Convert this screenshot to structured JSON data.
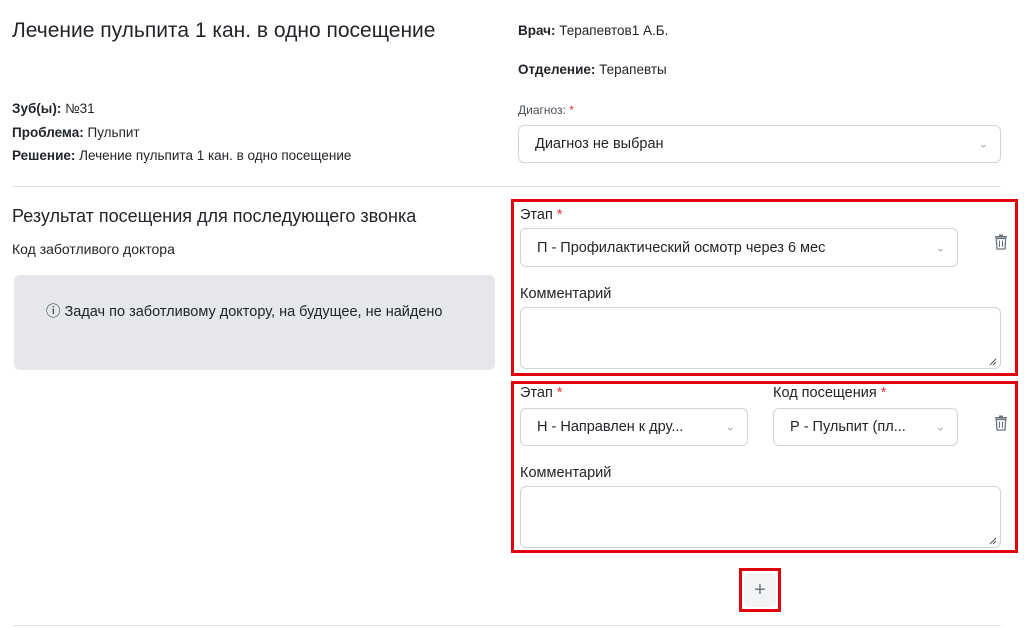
{
  "header": {
    "title": "Лечение пульпита 1 кан. в одно посещение",
    "teeth_label": "Зуб(ы):",
    "teeth_value": "№31",
    "problem_label": "Проблема:",
    "problem_value": "Пульпит",
    "solution_label": "Решение:",
    "solution_value": "Лечение пульпита 1 кан. в одно посещение"
  },
  "right_info": {
    "doctor_label": "Врач:",
    "doctor_value": "Терапевтов1 А.Б.",
    "department_label": "Отделение:",
    "department_value": "Терапевты",
    "diagnosis_label": "Диагноз:",
    "required_mark": "*",
    "diagnosis_value": "Диагноз не выбран"
  },
  "result_section": {
    "title": "Результат посещения для последующего звонка",
    "subtitle": "Код заботливого доктора",
    "alert_icon": "info-icon",
    "alert_text": "ⓘ Задач по заботливому доктору, на будущее, не найдено"
  },
  "entries": [
    {
      "stage_label": "Этап",
      "stage_value": "П - Профилактический осмотр через 6 мес",
      "comment_label": "Комментарий",
      "comment_value": ""
    },
    {
      "stage_label": "Этап",
      "stage_value": "Н - Направлен к дру...",
      "visit_code_label": "Код посещения",
      "visit_code_value": "Р - Пульпит (пл...",
      "comment_label": "Комментарий",
      "comment_value": ""
    }
  ],
  "add_button": {
    "label": "+"
  },
  "colors": {
    "highlight": "#e0000f",
    "required": "#dc3545",
    "alert_bg": "#e5e7ea",
    "border": "#ced4da"
  }
}
